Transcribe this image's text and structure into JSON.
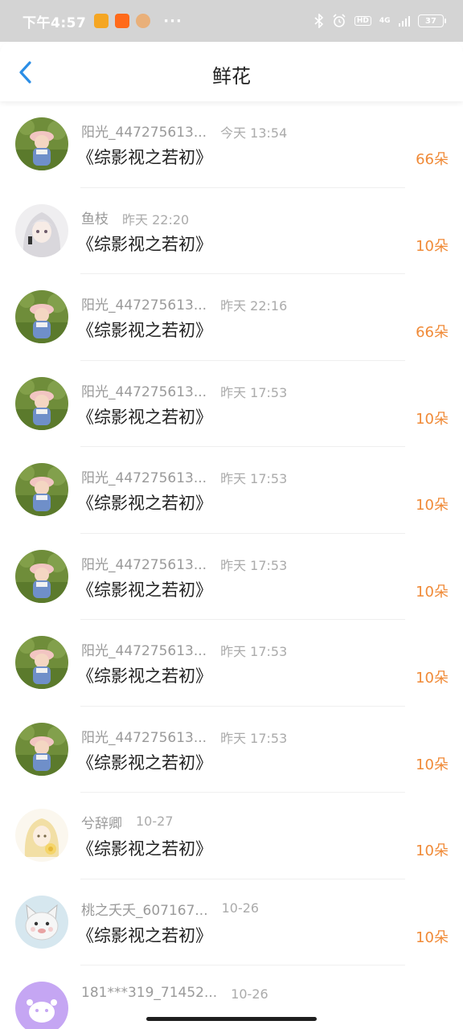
{
  "status_bar": {
    "time": "下午4:57",
    "more": "···",
    "network": "4G",
    "hd": "HD",
    "battery": "37"
  },
  "header": {
    "title": "鲜花"
  },
  "colors": {
    "accent": "#2b8ee6",
    "count": "#f08a37"
  },
  "items": [
    {
      "name": "阳光_447275613...",
      "time": "今天 13:54",
      "book": "《综影视之若初》",
      "count": "66朵",
      "avatar": "photo-girl"
    },
    {
      "name": "鱼枝",
      "time": "昨天 22:20",
      "book": "《综影视之若初》",
      "count": "10朵",
      "avatar": "anime-white-hair"
    },
    {
      "name": "阳光_447275613...",
      "time": "昨天 22:16",
      "book": "《综影视之若初》",
      "count": "66朵",
      "avatar": "photo-girl"
    },
    {
      "name": "阳光_447275613...",
      "time": "昨天 17:53",
      "book": "《综影视之若初》",
      "count": "10朵",
      "avatar": "photo-girl"
    },
    {
      "name": "阳光_447275613...",
      "time": "昨天 17:53",
      "book": "《综影视之若初》",
      "count": "10朵",
      "avatar": "photo-girl"
    },
    {
      "name": "阳光_447275613...",
      "time": "昨天 17:53",
      "book": "《综影视之若初》",
      "count": "10朵",
      "avatar": "photo-girl"
    },
    {
      "name": "阳光_447275613...",
      "time": "昨天 17:53",
      "book": "《综影视之若初》",
      "count": "10朵",
      "avatar": "photo-girl"
    },
    {
      "name": "阳光_447275613...",
      "time": "昨天 17:53",
      "book": "《综影视之若初》",
      "count": "10朵",
      "avatar": "photo-girl"
    },
    {
      "name": "兮辞卿",
      "time": "10-27",
      "book": "《综影视之若初》",
      "count": "10朵",
      "avatar": "anime-blonde"
    },
    {
      "name": "桃之夭夭_607167...",
      "time": "10-26",
      "book": "《综影视之若初》",
      "count": "10朵",
      "avatar": "cat-sticker"
    },
    {
      "name": "181***319_71452...",
      "time": "10-26",
      "book": "",
      "count": "",
      "avatar": "purple-default"
    }
  ]
}
